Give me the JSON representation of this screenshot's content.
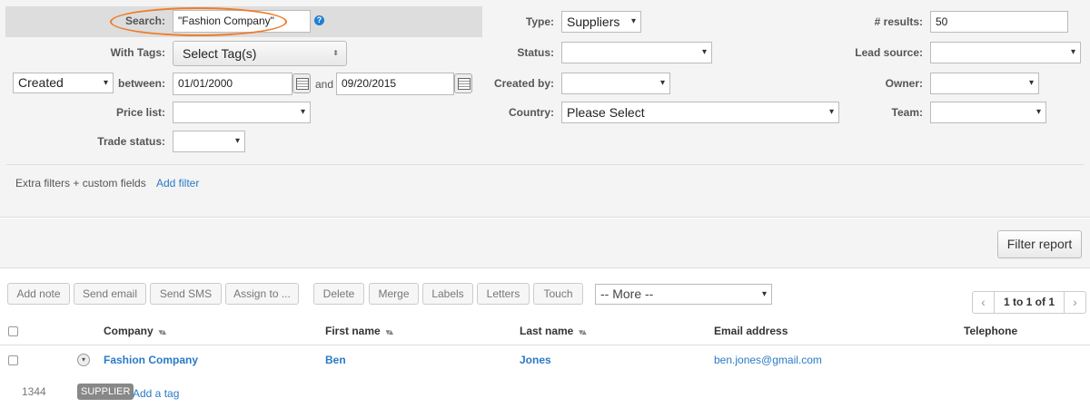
{
  "filters": {
    "search_label": "Search:",
    "search_value": "\"Fashion Company\"",
    "with_tags_label": "With Tags:",
    "tags_value": "Select Tag(s)",
    "date_field_value": "Created",
    "between_label": "between:",
    "date_from": "01/01/2000",
    "and_label": "and",
    "date_to": "09/20/2015",
    "price_list_label": "Price list:",
    "price_list_value": "",
    "trade_status_label": "Trade status:",
    "trade_status_value": "",
    "type_label": "Type:",
    "type_value": "Suppliers",
    "status_label": "Status:",
    "status_value": "",
    "created_by_label": "Created by:",
    "created_by_value": "",
    "country_label": "Country:",
    "country_value": "Please Select",
    "results_label": "# results:",
    "results_value": "50",
    "lead_source_label": "Lead source:",
    "lead_source_value": "",
    "owner_label": "Owner:",
    "owner_value": "",
    "team_label": "Team:",
    "team_value": "",
    "extra_filters_text": "Extra filters + custom fields",
    "add_filter_label": "Add filter",
    "filter_report_label": "Filter report"
  },
  "actions": {
    "add_note": "Add note",
    "send_email": "Send email",
    "send_sms": "Send SMS",
    "assign_to": "Assign to ...",
    "delete": "Delete",
    "merge": "Merge",
    "labels": "Labels",
    "letters": "Letters",
    "touch": "Touch",
    "more_value": "-- More --"
  },
  "pager": {
    "text": "1 to 1 of 1"
  },
  "table": {
    "columns": [
      "Company",
      "First name",
      "Last name",
      "Email address",
      "Telephone"
    ],
    "rows": [
      {
        "company": "Fashion Company",
        "first_name": "Ben",
        "last_name": "Jones",
        "email": "ben.jones@gmail.com",
        "telephone": "",
        "id": "1344",
        "tag": "SUPPLIER",
        "add_tag_label": "Add a tag"
      }
    ]
  },
  "colors": {
    "accent_link": "#2a7ac7",
    "highlight_oval": "#ef7c2a",
    "help_icon": "#1e7ed4"
  },
  "icons": [
    "help-icon",
    "calendar-icon",
    "chevron-down-icon",
    "sort-icon",
    "chevron-left-icon",
    "chevron-right-icon",
    "expand-row-icon"
  ]
}
